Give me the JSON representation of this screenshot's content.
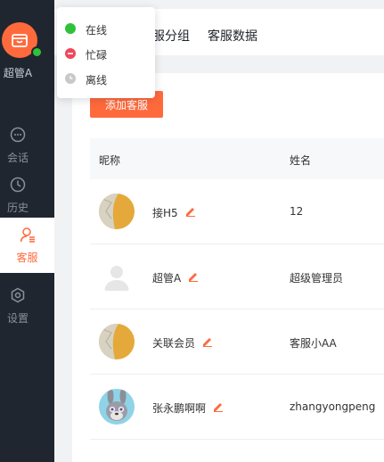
{
  "sidebar": {
    "user_name": "超管A",
    "items": [
      {
        "label": "会话",
        "icon": "chat-icon"
      },
      {
        "label": "历史",
        "icon": "clock-icon"
      },
      {
        "label": "客服",
        "icon": "agent-icon",
        "active": true
      },
      {
        "label": "设置",
        "icon": "gear-icon"
      }
    ]
  },
  "status_menu": {
    "items": [
      {
        "label": "在线",
        "color": "#2ec238"
      },
      {
        "label": "忙碌",
        "color": "#f0475b"
      },
      {
        "label": "离线",
        "color": "#c8c8c8"
      }
    ]
  },
  "header": {
    "tabs": [
      {
        "label": "服分组"
      },
      {
        "label": "客服数据"
      }
    ]
  },
  "main": {
    "add_button": "添加客服",
    "columns": [
      "昵称",
      "姓名"
    ],
    "rows": [
      {
        "nickname": "接H5",
        "name": "12",
        "avatar": "yellow-avatar"
      },
      {
        "nickname": "超管A",
        "name": "超级管理员",
        "avatar": "default-avatar"
      },
      {
        "nickname": "关联会员",
        "name": "客服小AA",
        "avatar": "yellow-avatar"
      },
      {
        "nickname": "张永鹏啊啊",
        "name": "zhangyongpeng",
        "avatar": "rabbit-avatar"
      }
    ]
  },
  "colors": {
    "accent": "#ff6a3d",
    "sidebar_bg": "#202630",
    "online": "#2ec238"
  }
}
